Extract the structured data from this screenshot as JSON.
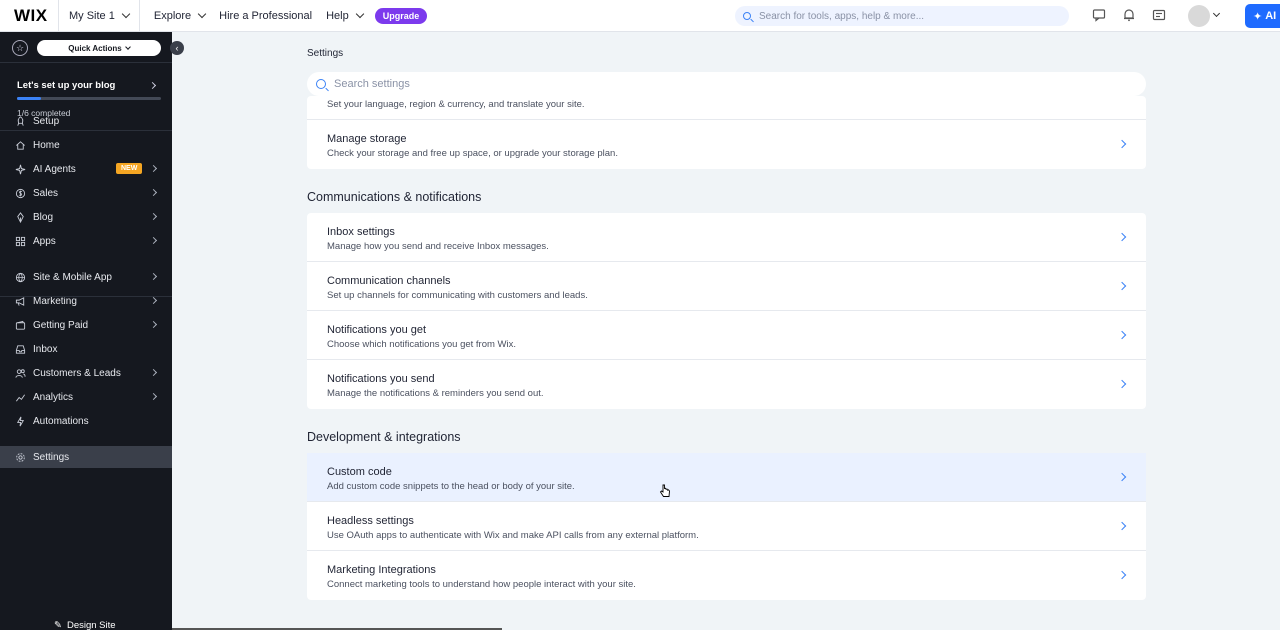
{
  "topbar": {
    "logo": "WIX",
    "site_selector": "My Site 1",
    "nav": [
      "Explore",
      "Hire a Professional",
      "Help"
    ],
    "upgrade_label": "Upgrade",
    "search_placeholder": "Search for tools, apps, help & more...",
    "ai_label": "AI",
    "accent_color": "#1f6bff",
    "upgrade_color": "#7c3aed"
  },
  "sidebar": {
    "quick_actions": "Quick Actions",
    "setup_title": "Let's set up your blog",
    "progress_text": "1/6 completed",
    "progress_fraction": 0.17,
    "items": [
      {
        "label": "Setup",
        "icon": "rocket-icon",
        "has_chevron": false
      },
      {
        "label": "Home",
        "icon": "home-icon",
        "has_chevron": false
      },
      {
        "label": "AI Agents",
        "icon": "sparkle-icon",
        "has_chevron": true,
        "badge": "NEW"
      },
      {
        "label": "Sales",
        "icon": "dollar-icon",
        "has_chevron": true
      },
      {
        "label": "Blog",
        "icon": "pen-icon",
        "has_chevron": true
      },
      {
        "label": "Apps",
        "icon": "apps-icon",
        "has_chevron": true
      },
      {
        "label": "Site & Mobile App",
        "icon": "globe-icon",
        "has_chevron": true
      },
      {
        "label": "Marketing",
        "icon": "megaphone-icon",
        "has_chevron": true
      },
      {
        "label": "Getting Paid",
        "icon": "wallet-icon",
        "has_chevron": true
      },
      {
        "label": "Inbox",
        "icon": "inbox-icon",
        "has_chevron": false
      },
      {
        "label": "Customers & Leads",
        "icon": "people-icon",
        "has_chevron": true
      },
      {
        "label": "Analytics",
        "icon": "chart-icon",
        "has_chevron": true
      },
      {
        "label": "Automations",
        "icon": "bolt-icon",
        "has_chevron": false
      },
      {
        "label": "Settings",
        "icon": "gear-icon",
        "has_chevron": false,
        "active": true
      }
    ],
    "design_site": "Design Site"
  },
  "main": {
    "page_title": "Settings",
    "search_placeholder": "Search settings",
    "clipped_desc": "Set your language, region & currency, and translate your site.",
    "storage": {
      "title": "Manage storage",
      "desc": "Check your storage and free up space, or upgrade your storage plan."
    },
    "sections": [
      {
        "title": "Communications & notifications",
        "rows": [
          {
            "title": "Inbox settings",
            "desc": "Manage how you send and receive Inbox messages."
          },
          {
            "title": "Communication channels",
            "desc": "Set up channels for communicating with customers and leads."
          },
          {
            "title": "Notifications you get",
            "desc": "Choose which notifications you get from Wix."
          },
          {
            "title": "Notifications you send",
            "desc": "Manage the notifications & reminders you send out."
          }
        ]
      },
      {
        "title": "Development & integrations",
        "rows": [
          {
            "title": "Custom code",
            "desc": "Add custom code snippets to the head or body of your site."
          },
          {
            "title": "Headless settings",
            "desc": "Use OAuth apps to authenticate with Wix and make API calls from any external platform."
          },
          {
            "title": "Marketing Integrations",
            "desc": "Connect marketing tools to understand how people interact with your site."
          }
        ]
      }
    ]
  }
}
